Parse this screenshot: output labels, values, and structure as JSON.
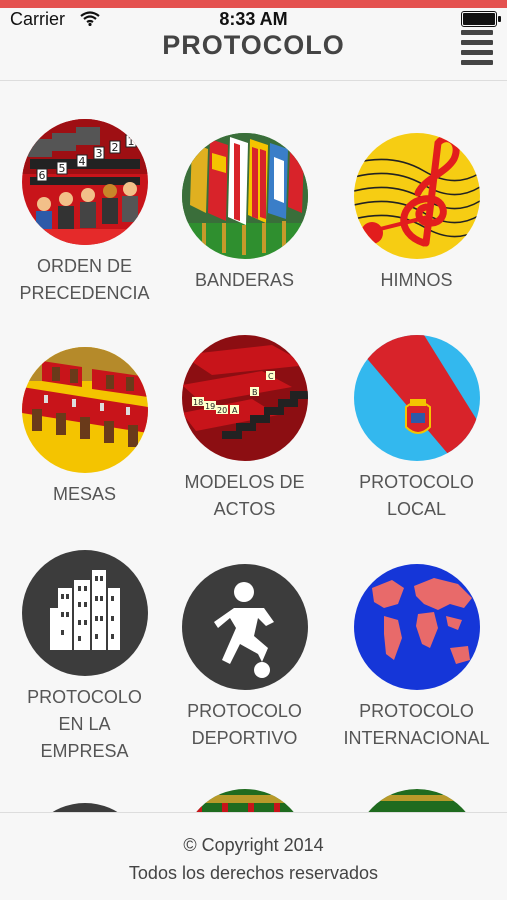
{
  "status": {
    "carrier": "Carrier",
    "time": "8:33 AM",
    "battery_level": 1.0
  },
  "header": {
    "title": "PROTOCOLO"
  },
  "tiles": [
    {
      "label_line1": "ORDEN DE",
      "label_line2": "PRECEDENCIA",
      "label_line3": ""
    },
    {
      "label_line1": "BANDERAS",
      "label_line2": "",
      "label_line3": ""
    },
    {
      "label_line1": "HIMNOS",
      "label_line2": "",
      "label_line3": ""
    },
    {
      "label_line1": "MESAS",
      "label_line2": "",
      "label_line3": ""
    },
    {
      "label_line1": "MODELOS DE",
      "label_line2": "ACTOS",
      "label_line3": ""
    },
    {
      "label_line1": "PROTOCOLO",
      "label_line2": "LOCAL",
      "label_line3": ""
    },
    {
      "label_line1": "PROTOCOLO",
      "label_line2": "EN LA",
      "label_line3": "EMPRESA"
    },
    {
      "label_line1": "PROTOCOLO",
      "label_line2": "DEPORTIVO",
      "label_line3": ""
    },
    {
      "label_line1": "PROTOCOLO",
      "label_line2": "INTERNACIONAL",
      "label_line3": ""
    }
  ],
  "precedence_numbers": [
    "1",
    "2",
    "3",
    "4",
    "5",
    "6"
  ],
  "stairs_labels": [
    "A",
    "B",
    "C",
    "18",
    "19",
    "20"
  ],
  "footer": {
    "copyright": "© Copyright 2014",
    "rights": "Todos los derechos reservados"
  }
}
